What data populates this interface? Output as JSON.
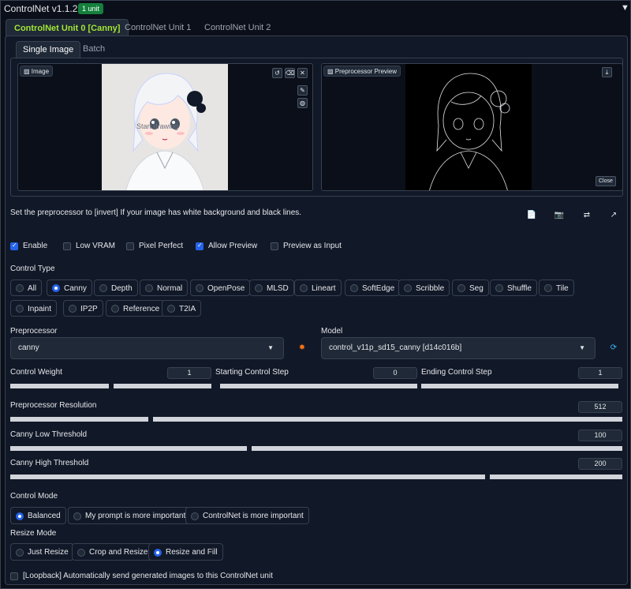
{
  "header": {
    "title": "ControlNet v1.1.234",
    "badge": "1 unit"
  },
  "unit_tabs": [
    "ControlNet Unit 0 [Canny]",
    "ControlNet Unit 1",
    "ControlNet Unit 2"
  ],
  "image_tabs": [
    "Single Image",
    "Batch"
  ],
  "image_panel": {
    "label": "Image",
    "overlay_text": "Start drawing"
  },
  "preview_panel": {
    "label": "Preprocessor Preview",
    "close_label": "Close"
  },
  "hint": "Set the preprocessor to [invert] If your image has white background and black lines.",
  "checkboxes": [
    {
      "label": "Enable",
      "checked": true
    },
    {
      "label": "Low VRAM",
      "checked": false
    },
    {
      "label": "Pixel Perfect",
      "checked": false
    },
    {
      "label": "Allow Preview",
      "checked": true
    },
    {
      "label": "Preview as Input",
      "checked": false
    }
  ],
  "control_type": {
    "label": "Control Type",
    "options": [
      "All",
      "Canny",
      "Depth",
      "Normal",
      "OpenPose",
      "MLSD",
      "Lineart",
      "SoftEdge",
      "Scribble",
      "Seg",
      "Shuffle",
      "Tile",
      "Inpaint",
      "IP2P",
      "Reference",
      "T2IA"
    ],
    "selected": "Canny"
  },
  "preprocessor": {
    "label": "Preprocessor",
    "value": "canny"
  },
  "model": {
    "label": "Model",
    "value": "control_v11p_sd15_canny [d14c016b]"
  },
  "sliders": {
    "control_weight": {
      "label": "Control Weight",
      "value": "1",
      "fraction": 0.5
    },
    "starting_step": {
      "label": "Starting Control Step",
      "value": "0",
      "fraction": 0.0
    },
    "ending_step": {
      "label": "Ending Control Step",
      "value": "1",
      "fraction": 1.0
    },
    "resolution": {
      "label": "Preprocessor Resolution",
      "value": "512",
      "fraction": 0.23
    },
    "low_threshold": {
      "label": "Canny Low Threshold",
      "value": "100",
      "fraction": 0.39
    },
    "high_threshold": {
      "label": "Canny High Threshold",
      "value": "200",
      "fraction": 0.78
    }
  },
  "control_mode": {
    "label": "Control Mode",
    "options": [
      "Balanced",
      "My prompt is more important",
      "ControlNet is more important"
    ],
    "selected": "Balanced"
  },
  "resize_mode": {
    "label": "Resize Mode",
    "options": [
      "Just Resize",
      "Crop and Resize",
      "Resize and Fill"
    ],
    "selected": "Resize and Fill"
  },
  "loopback": {
    "label": "[Loopback] Automatically send generated images to this ControlNet unit",
    "checked": false
  },
  "colors": {
    "accent": "#2563eb",
    "tab_active": "#a3e635",
    "badge": "#15803d",
    "background": "#0b0f19"
  }
}
